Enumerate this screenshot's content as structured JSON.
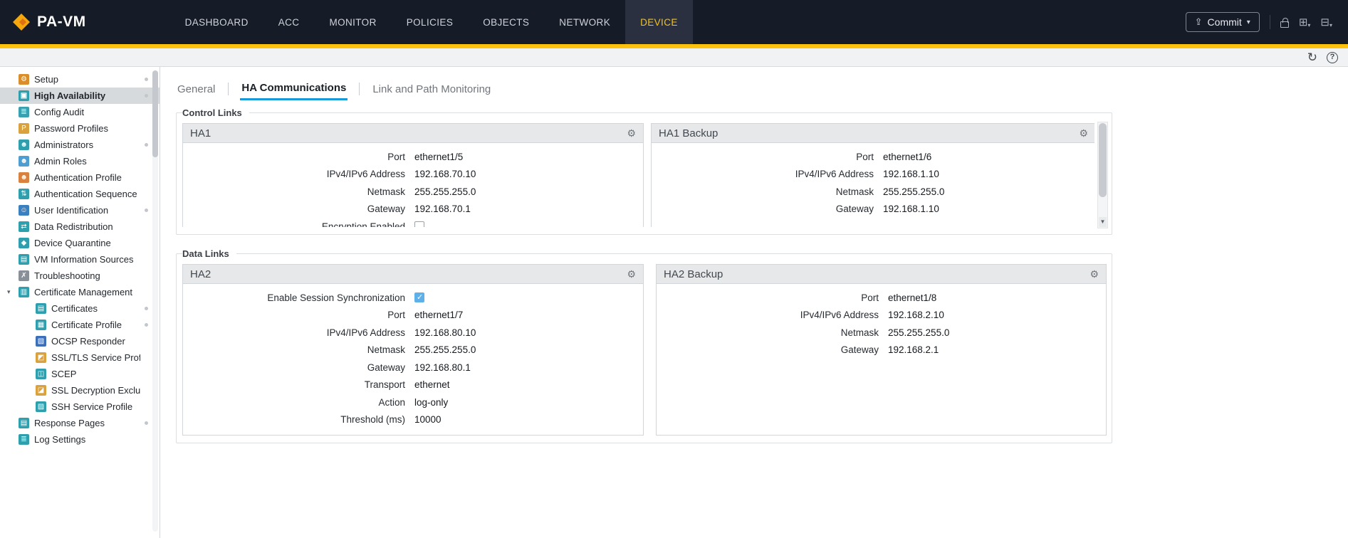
{
  "header": {
    "logo_text": "PA-VM",
    "nav_items": [
      {
        "label": "DASHBOARD"
      },
      {
        "label": "ACC"
      },
      {
        "label": "MONITOR"
      },
      {
        "label": "POLICIES"
      },
      {
        "label": "OBJECTS"
      },
      {
        "label": "NETWORK"
      },
      {
        "label": "DEVICE",
        "active": true
      }
    ],
    "commit_label": "Commit"
  },
  "sidebar": {
    "items": [
      {
        "label": "Setup",
        "icon": "gear-icon",
        "glyph": "⚙",
        "color": "#d98e2b",
        "dot": true
      },
      {
        "label": "High Availability",
        "icon": "high-availability-icon",
        "glyph": "▣",
        "color": "#2f9fae",
        "selected": true,
        "dot": true
      },
      {
        "label": "Config Audit",
        "icon": "config-audit-icon",
        "glyph": "≣",
        "color": "#38a0ae"
      },
      {
        "label": "Password Profiles",
        "icon": "password-key-icon",
        "glyph": "P",
        "color": "#d9a23f"
      },
      {
        "label": "Administrators",
        "icon": "administrators-icon",
        "glyph": "☻",
        "color": "#2f9fae",
        "dot": true
      },
      {
        "label": "Admin Roles",
        "icon": "admin-roles-icon",
        "glyph": "☻",
        "color": "#4f9ed1"
      },
      {
        "label": "Authentication Profile",
        "icon": "authentication-profile-icon",
        "glyph": "☻",
        "color": "#d9813f"
      },
      {
        "label": "Authentication Sequence",
        "icon": "authentication-sequence-icon",
        "glyph": "⇅",
        "color": "#2f9fae"
      },
      {
        "label": "User Identification",
        "icon": "user-identification-icon",
        "glyph": "☺",
        "color": "#3a7fbf",
        "dot": true
      },
      {
        "label": "Data Redistribution",
        "icon": "data-redistribution-icon",
        "glyph": "⇄",
        "color": "#2f9fae"
      },
      {
        "label": "Device Quarantine",
        "icon": "device-quarantine-icon",
        "glyph": "◆",
        "color": "#2f9fae"
      },
      {
        "label": "VM Information Sources",
        "icon": "vm-information-sources-icon",
        "glyph": "▤",
        "color": "#2f9fae"
      },
      {
        "label": "Troubleshooting",
        "icon": "troubleshooting-icon",
        "glyph": "✗",
        "color": "#8a9097"
      },
      {
        "label": "Certificate Management",
        "icon": "certificate-management-icon",
        "glyph": "▥",
        "color": "#2f9fae",
        "expandable": true
      },
      {
        "label": "Certificates",
        "icon": "certificates-icon",
        "glyph": "▤",
        "color": "#2f9fae",
        "indent": true,
        "dot": true
      },
      {
        "label": "Certificate Profile",
        "icon": "certificate-profile-icon",
        "glyph": "▦",
        "color": "#2f9fae",
        "indent": true,
        "dot": true
      },
      {
        "label": "OCSP Responder",
        "icon": "ocsp-responder-icon",
        "glyph": "▧",
        "color": "#3d6fb8",
        "indent": true
      },
      {
        "label": "SSL/TLS Service Profile",
        "icon": "ssl-tls-service-profile-icon",
        "glyph": "◩",
        "color": "#d9a23f",
        "indent": true
      },
      {
        "label": "SCEP",
        "icon": "scep-icon",
        "glyph": "◫",
        "color": "#2f9fae",
        "indent": true
      },
      {
        "label": "SSL Decryption Exclusio",
        "icon": "ssl-decryption-exclusion-icon",
        "glyph": "◪",
        "color": "#d9a23f",
        "indent": true
      },
      {
        "label": "SSH Service Profile",
        "icon": "ssh-service-profile-icon",
        "glyph": "▨",
        "color": "#2f9fae",
        "indent": true
      },
      {
        "label": "Response Pages",
        "icon": "response-pages-icon",
        "glyph": "▤",
        "color": "#2f9fae",
        "dot": true
      },
      {
        "label": "Log Settings",
        "icon": "log-settings-icon",
        "glyph": "≣",
        "color": "#2f9fae"
      }
    ]
  },
  "tabs": [
    {
      "label": "General"
    },
    {
      "label": "HA Communications",
      "active": true
    },
    {
      "label": "Link and Path Monitoring"
    }
  ],
  "sections": [
    {
      "legend": "Control Links",
      "panels": [
        {
          "title": "HA1",
          "rows": [
            {
              "label": "Port",
              "value": "ethernet1/5"
            },
            {
              "label": "IPv4/IPv6 Address",
              "value": "192.168.70.10"
            },
            {
              "label": "Netmask",
              "value": "255.255.255.0"
            },
            {
              "label": "Gateway",
              "value": "192.168.70.1"
            },
            {
              "label": "Encryption Enabled",
              "is_checkbox": true,
              "checked": false
            }
          ]
        },
        {
          "title": "HA1 Backup",
          "rows": [
            {
              "label": "Port",
              "value": "ethernet1/6"
            },
            {
              "label": "IPv4/IPv6 Address",
              "value": "192.168.1.10"
            },
            {
              "label": "Netmask",
              "value": "255.255.255.0"
            },
            {
              "label": "Gateway",
              "value": "192.168.1.10"
            }
          ]
        }
      ]
    },
    {
      "legend": "Data Links",
      "panels": [
        {
          "title": "HA2",
          "rows": [
            {
              "label": "Enable Session Synchronization",
              "is_checkbox": true,
              "checked": true
            },
            {
              "label": "Port",
              "value": "ethernet1/7"
            },
            {
              "label": "IPv4/IPv6 Address",
              "value": "192.168.80.10"
            },
            {
              "label": "Netmask",
              "value": "255.255.255.0"
            },
            {
              "label": "Gateway",
              "value": "192.168.80.1"
            },
            {
              "label": "Transport",
              "value": "ethernet"
            },
            {
              "label": "Action",
              "value": "log-only"
            },
            {
              "label": "Threshold (ms)",
              "value": "10000"
            }
          ]
        },
        {
          "title": "HA2 Backup",
          "rows": [
            {
              "label": "Port",
              "value": "ethernet1/8"
            },
            {
              "label": "IPv4/IPv6 Address",
              "value": "192.168.2.10"
            },
            {
              "label": "Netmask",
              "value": "255.255.255.0"
            },
            {
              "label": "Gateway",
              "value": "192.168.2.1"
            }
          ]
        }
      ]
    }
  ],
  "colors": {
    "accent_yellow": "#fec10e",
    "nav_background": "#161b28",
    "active_nav_text": "#f3c21c",
    "tab_underline": "#189ad8",
    "checkbox_checked": "#5fb0e8",
    "selected_item_background": "#d7dadd"
  }
}
